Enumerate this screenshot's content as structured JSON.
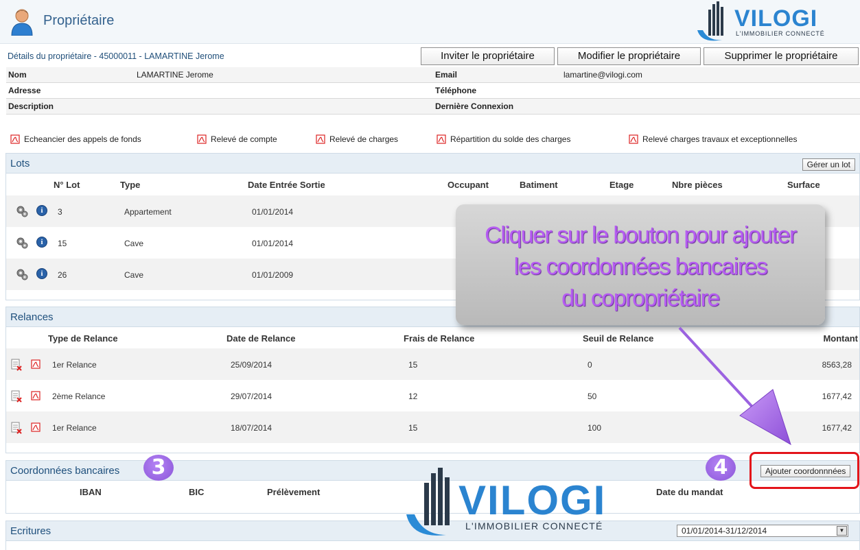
{
  "header": {
    "title": "Propriétaire",
    "logo": {
      "name": "VILOGI",
      "tagline": "L'IMMOBILIER CONNECTÉ"
    }
  },
  "details": {
    "title": "Détails du propriétaire - 45000011 - LAMARTINE Jerome",
    "buttons": {
      "invite": "Inviter le propriétaire",
      "edit": "Modifier le propriétaire",
      "delete": "Supprimer le propriétaire"
    },
    "fields": {
      "nom_label": "Nom",
      "nom_value": "LAMARTINE Jerome",
      "email_label": "Email",
      "email_value": "lamartine@vilogi.com",
      "adresse_label": "Adresse",
      "telephone_label": "Téléphone",
      "description_label": "Description",
      "derniere_connexion_label": "Dernière Connexion"
    }
  },
  "pdf_links": [
    "Echeancier des appels de fonds",
    "Relevé de compte",
    "Relevé de charges",
    "Répartition du solde des charges",
    "Relevé charges travaux et exceptionnelles"
  ],
  "lots": {
    "title": "Lots",
    "manage_button": "Gérer un lot",
    "columns": [
      "N° Lot",
      "Type",
      "Date Entrée Sortie",
      "Occupant",
      "Batiment",
      "Etage",
      "Nbre pièces",
      "Surface"
    ],
    "rows": [
      {
        "num": "3",
        "type": "Appartement",
        "date": "01/01/2014"
      },
      {
        "num": "15",
        "type": "Cave",
        "date": "01/01/2014"
      },
      {
        "num": "26",
        "type": "Cave",
        "date": "01/01/2009"
      }
    ]
  },
  "relances": {
    "title": "Relances",
    "columns": [
      "Type de Relance",
      "Date de Relance",
      "Frais de Relance",
      "Seuil de Relance",
      "Montant"
    ],
    "rows": [
      {
        "type": "1er Relance",
        "date": "25/09/2014",
        "frais": "15",
        "seuil": "0",
        "montant": "8563,28"
      },
      {
        "type": "2ème Relance",
        "date": "29/07/2014",
        "frais": "12",
        "seuil": "50",
        "montant": "1677,42"
      },
      {
        "type": "1er Relance",
        "date": "18/07/2014",
        "frais": "15",
        "seuil": "100",
        "montant": "1677,42"
      }
    ]
  },
  "coordonnees": {
    "title": "Coordonnées bancaires",
    "add_button": "Ajouter coordonnnées",
    "columns": [
      "IBAN",
      "BIC",
      "Prélèvement",
      "Date du mandat"
    ]
  },
  "ecritures": {
    "title": "Ecritures",
    "period": "01/01/2014-31/12/2014"
  },
  "annotation": {
    "callout_lines": [
      "Cliquer sur le bouton pour ajouter",
      "les coordonnées bancaires",
      "du copropriétaire"
    ],
    "badge_3": "3",
    "badge_4": "4",
    "callout_color": "#b65cf2",
    "frame_color": "#e3141a"
  }
}
